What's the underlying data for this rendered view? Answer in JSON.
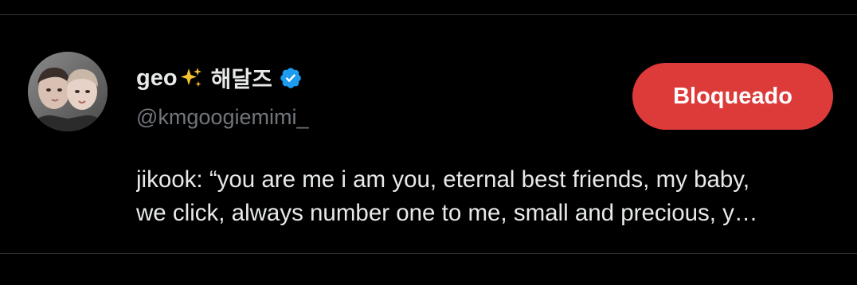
{
  "profile": {
    "display_name": "geo",
    "emoji": "sparkles",
    "korean_name": "해달즈",
    "verified": true,
    "handle": "@kmgoogiemimi_",
    "avatar": "avatar-photo"
  },
  "action": {
    "block_label": "Bloqueado",
    "block_color": "#dd3a3a"
  },
  "bio": {
    "line1": "jikook: “you are me i am you, eternal best friends, my baby,",
    "line2": "we click, always number one to me, small and precious, y…"
  },
  "colors": {
    "background": "#000000",
    "text": "#e7e9ea",
    "muted": "#71767b",
    "divider": "#2f3336",
    "verified": "#1d9bf0"
  },
  "icons": [
    "sparkle-icon",
    "verified-badge-icon"
  ]
}
